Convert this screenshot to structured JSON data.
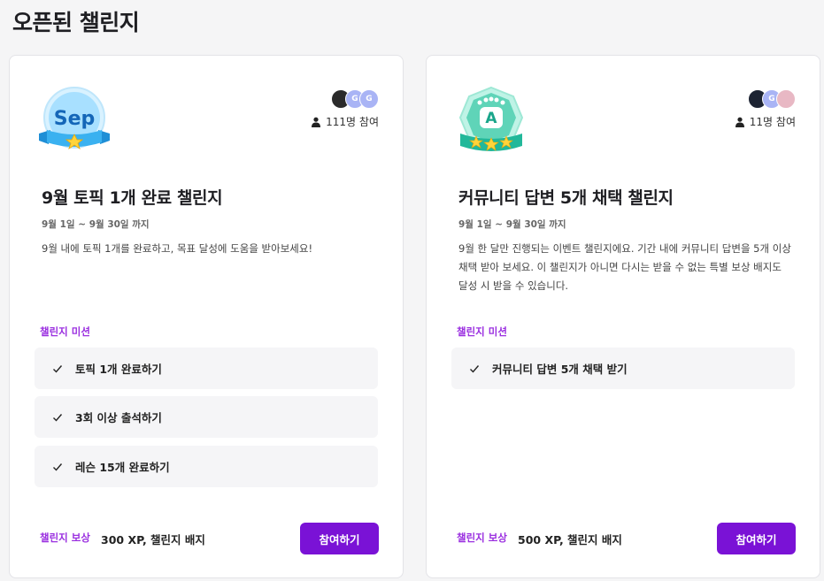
{
  "page": {
    "title": "오픈된 챌린지"
  },
  "challenges": [
    {
      "badge_text": "Sep",
      "participants": "111명 참여",
      "title": "9월 토픽 1개 완료 챌린지",
      "date": "9월 1일 ~ 9월 30일 까지",
      "description": "9월 내에 토픽 1개를 완료하고, 목표 달성에 도움을 받아보세요!",
      "mission_label": "챌린지 미션",
      "missions": [
        "토픽 1개 완료하기",
        "3회 이상 출석하기",
        "레슨 15개 완료하기"
      ],
      "reward_label": "챌린지 보상",
      "reward_value": "300 XP, 챌린지 배지",
      "button_label": "참여하기"
    },
    {
      "badge_text": "A",
      "participants": "11명 참여",
      "title": "커뮤니티 답변 5개 채택 챌린지",
      "date": "9월 1일 ~ 9월 30일 까지",
      "description": "9월 한 달만 진행되는 이벤트 챌린지에요. 기간 내에 커뮤니티 답변을 5개 이상 채택 받아 보세요. 이 챌린지가 아니면 다시는 받을 수 없는 특별 보상 배지도 달성 시 받을 수 있습니다.",
      "mission_label": "챌린지 미션",
      "missions": [
        "커뮤니티 답변 5개 채택 받기"
      ],
      "reward_label": "챌린지 보상",
      "reward_value": "500 XP, 챌린지 배지",
      "button_label": "참여하기"
    }
  ],
  "colors": {
    "accent": "#7a12d6",
    "accent_text": "#9b30e0",
    "mission_bg": "#f5f5f7"
  },
  "icons": [
    "person-icon",
    "check-icon",
    "avatar"
  ]
}
